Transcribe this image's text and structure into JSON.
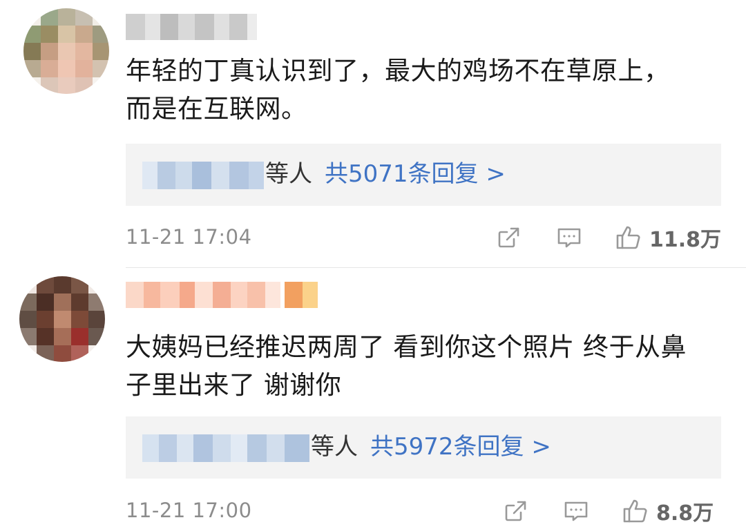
{
  "comments": [
    {
      "text": "年轻的丁真认识到了，最大的鸡场不在草原上，\n而是在互联网。",
      "replies": {
        "suffix": "等人",
        "link": "共5071条回复 >"
      },
      "timestamp": "11-21 17:04",
      "likes": "11.8万"
    },
    {
      "text": "大姨妈已经推迟两周了 看到你这个照片 终于从鼻\n子里出来了 谢谢你",
      "replies": {
        "suffix": "等人",
        "link": "共5972条回复 >"
      },
      "timestamp": "11-21 17:00",
      "likes": "8.8万"
    }
  ],
  "icons": {
    "share": "share-icon",
    "comment": "comment-icon",
    "like": "thumbs-up-icon"
  },
  "colors": {
    "link": "#3f73c4",
    "reply_bg": "#f3f3f3",
    "meta": "#8c8c8c"
  }
}
